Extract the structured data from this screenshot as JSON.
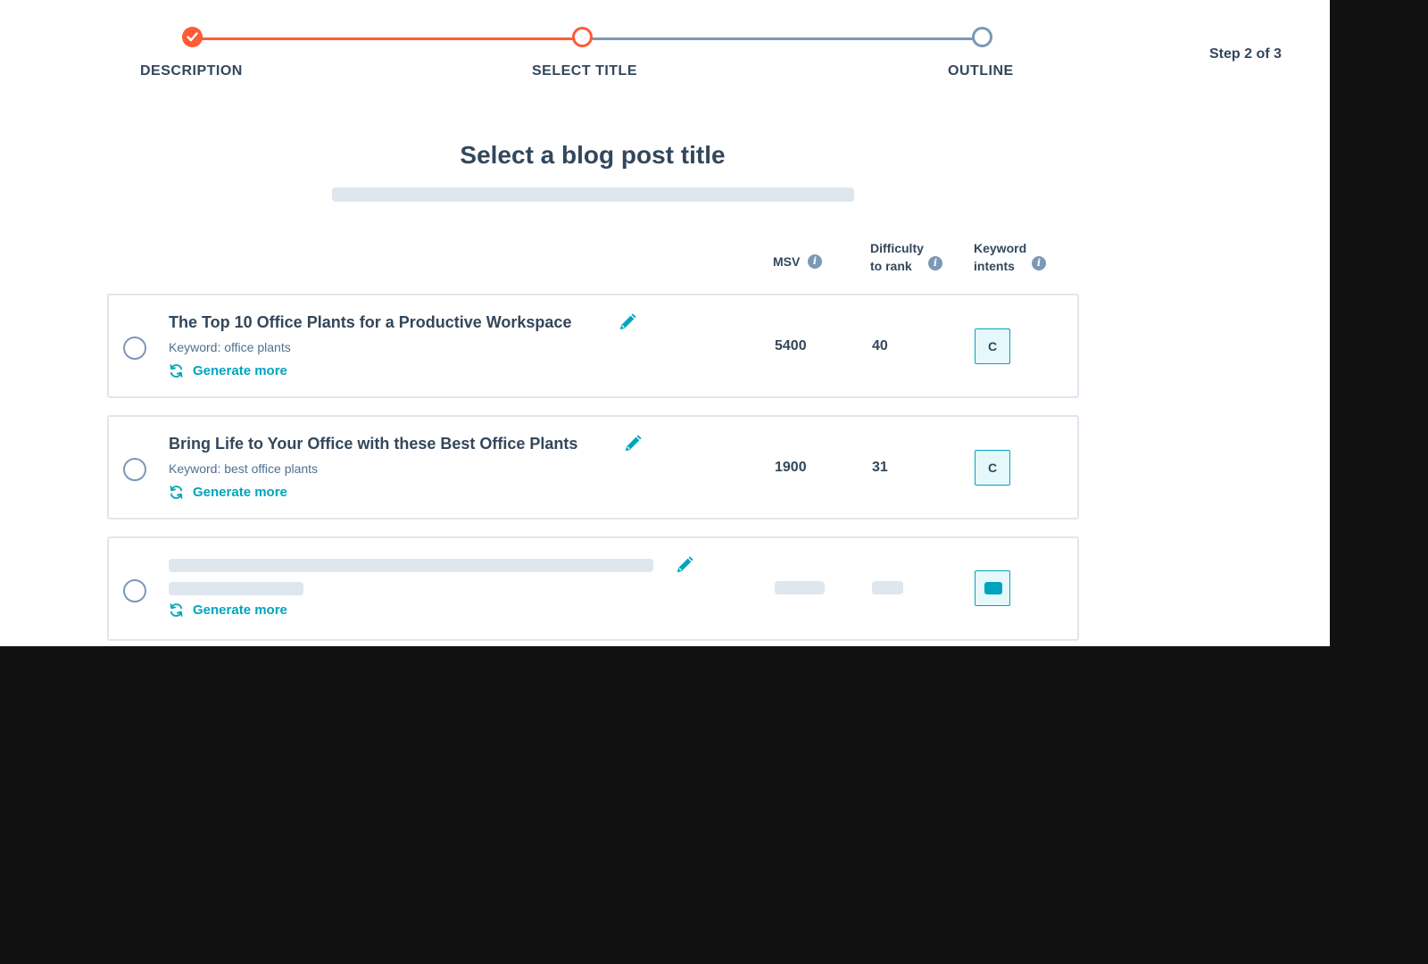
{
  "stepper": {
    "steps": [
      {
        "label": "DESCRIPTION",
        "state": "done"
      },
      {
        "label": "SELECT TITLE",
        "state": "current"
      },
      {
        "label": "OUTLINE",
        "state": "todo"
      }
    ],
    "step_count": "Step 2 of 3"
  },
  "heading": "Select a blog post title",
  "columns": {
    "msv": "MSV",
    "difficulty": "Difficulty to rank",
    "intents": "Keyword intents"
  },
  "titles": [
    {
      "title": "The Top 10 Office Plants for a Productive Workspace",
      "keyword": "Keyword: office plants",
      "generate_more": "Generate more",
      "msv": "5400",
      "difficulty": "40",
      "intent": "C"
    },
    {
      "title": "Bring Life to Your Office with these Best Office Plants",
      "keyword": "Keyword: best office plants",
      "generate_more": "Generate more",
      "msv": "1900",
      "difficulty": "31",
      "intent": "C"
    },
    {
      "loading": true,
      "generate_more": "Generate more"
    }
  ],
  "colors": {
    "accent_orange": "#ff5c35",
    "teal": "#00a4bd",
    "text_dark": "#33475b",
    "skeleton": "#dfe6ee"
  }
}
